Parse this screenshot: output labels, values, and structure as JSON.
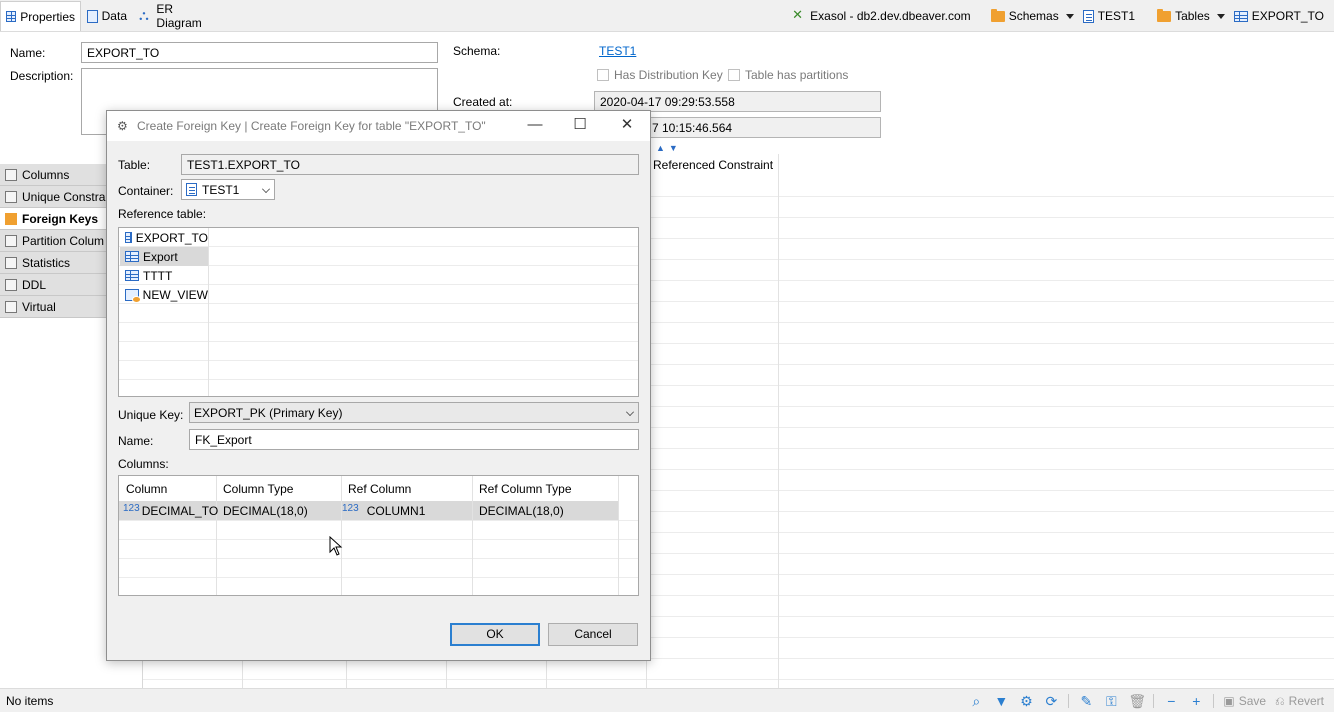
{
  "tabs": [
    {
      "label": "Properties",
      "icon": "table-icon"
    },
    {
      "label": "Data",
      "icon": "data-icon"
    },
    {
      "label": "ER Diagram",
      "icon": "er-diagram-icon"
    }
  ],
  "breadcrumbs": {
    "connection": "Exasol - db2.dev.dbeaver.com",
    "schemas": "Schemas",
    "schema": "TEST1",
    "tables": "Tables",
    "table": "EXPORT_TO"
  },
  "properties": {
    "name_label": "Name:",
    "name_value": "EXPORT_TO",
    "description_label": "Description:",
    "schema_label": "Schema:",
    "schema_value": "TEST1",
    "has_distribution_key": "Has Distribution Key",
    "table_has_partitions": "Table has partitions",
    "created_label": "Created at:",
    "created_value": "2020-04-17 09:29:53.558",
    "modified_value": "7 10:15:46.564"
  },
  "sidenav": [
    {
      "label": "Columns",
      "active": false
    },
    {
      "label": "Unique Constra",
      "active": false
    },
    {
      "label": "Foreign Keys",
      "active": true
    },
    {
      "label": "Partition Colum",
      "active": false
    },
    {
      "label": "Statistics",
      "active": false
    },
    {
      "label": "DDL",
      "active": false
    },
    {
      "label": "Virtual",
      "active": false
    }
  ],
  "background_grid": {
    "header": "Referenced Constraint"
  },
  "dialog": {
    "title": "Create Foreign Key | Create Foreign Key for table \"EXPORT_TO\"",
    "table_label": "Table:",
    "table_value": "TEST1.EXPORT_TO",
    "container_label": "Container:",
    "container_value": "TEST1",
    "reference_table_label": "Reference table:",
    "reference_tables": [
      {
        "label": "EXPORT_TO",
        "type": "table",
        "selected": false
      },
      {
        "label": "Export",
        "type": "table",
        "selected": true
      },
      {
        "label": "TTTT",
        "type": "table",
        "selected": false
      },
      {
        "label": "NEW_VIEW",
        "type": "view",
        "selected": false
      }
    ],
    "unique_key_label": "Unique Key:",
    "unique_key_value": "EXPORT_PK (Primary Key)",
    "name_label": "Name:",
    "name_value": "FK_Export",
    "columns_label": "Columns:",
    "columns_headers": [
      "Column",
      "Column Type",
      "Ref Column",
      "Ref Column Type"
    ],
    "columns_rows": [
      {
        "column": "DECIMAL_TO",
        "column_type": "DECIMAL(18,0)",
        "ref_column": "COLUMN1",
        "ref_column_type": "DECIMAL(18,0)"
      }
    ],
    "num_icon": "123",
    "ok_label": "OK",
    "cancel_label": "Cancel"
  },
  "statusbar": {
    "text": "No items",
    "save_label": "Save",
    "revert_label": "Revert"
  },
  "colors": {
    "accent": "#2b7fd0",
    "folder": "#f0a030",
    "link": "#0066cc"
  }
}
